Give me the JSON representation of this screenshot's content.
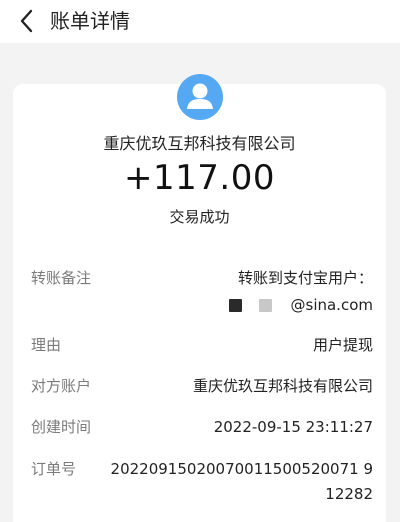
{
  "header": {
    "title": "账单详情"
  },
  "summary": {
    "merchant": "重庆优玖互邦科技有限公司",
    "amount": "+117.00",
    "status": "交易成功"
  },
  "details": {
    "remark_label": "转账备注",
    "remark_line1": "转账到支付宝用户：",
    "remark_line2_suffix": "@sina.com",
    "reason_label": "理由",
    "reason_value": "用户提现",
    "account_label": "对方账户",
    "account_value": "重庆优玖互邦科技有限公司",
    "created_label": "创建时间",
    "created_value": "2022-09-15 23:11:27",
    "order_label": "订单号",
    "order_line1": "20220915020070011500520071 9",
    "order_line2": "12282"
  },
  "colors": {
    "page_bg": "#f3f3f3",
    "card_bg": "#ffffff",
    "avatar": "#55a9f3",
    "label": "#7b7b7b",
    "text": "#222222"
  },
  "icons": {
    "back": "chevron-left-icon",
    "avatar": "user-avatar-icon"
  }
}
